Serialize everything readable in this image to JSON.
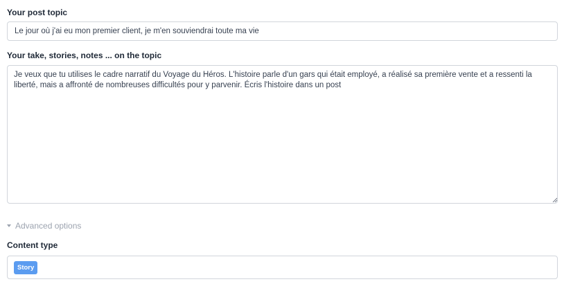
{
  "form": {
    "topic_label": "Your post topic",
    "topic_value": "Le jour où j'ai eu mon premier client, je m'en souviendrai toute ma vie",
    "take_label": "Your take, stories, notes ... on the topic",
    "take_value": "Je veux que tu utilises le cadre narratif du Voyage du Héros. L'histoire parle d'un gars qui était employé, a réalisé sa première vente et a ressenti la liberté, mais a affronté de nombreuses difficultés pour y parvenir. Écris l'histoire dans un post",
    "advanced_label": "Advanced options",
    "content_type_label": "Content type",
    "content_type_selected": "Story"
  },
  "icons": {
    "advanced_toggle": "caret-down-icon",
    "textarea_resize": "resize-grip-icon"
  },
  "colors": {
    "tag_background": "#5b9cf0",
    "border": "#d1d5db",
    "muted_text": "#9ca3af"
  }
}
